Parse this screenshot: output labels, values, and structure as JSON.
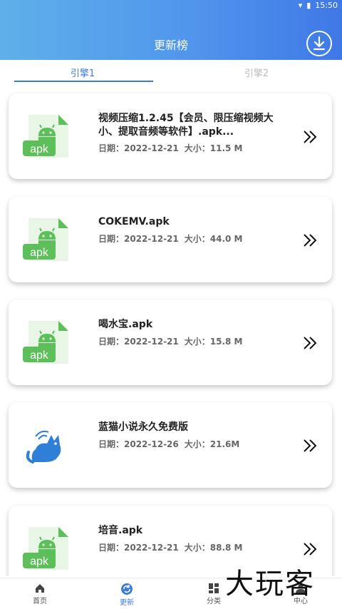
{
  "status": {
    "time": "15:50"
  },
  "header": {
    "title": "更新榜"
  },
  "tabs": [
    {
      "label": "引擎1",
      "active": true
    },
    {
      "label": "引擎2",
      "active": false
    }
  ],
  "items": [
    {
      "title": "视频压缩1.2.45【会员、限压缩视频大小、提取音频等软件】.apk...",
      "date": "日期：2022-12-21",
      "size": "大小：11.5 M",
      "icon": "apk-icon"
    },
    {
      "title": "COKEMV.apk",
      "date": "日期：2022-12-21",
      "size": "大小：44.0 M",
      "icon": "apk-icon"
    },
    {
      "title": "喝水宝.apk",
      "date": "日期：2022-12-21",
      "size": "大小：15.8 M",
      "icon": "apk-icon"
    },
    {
      "title": "蓝猫小说永久免费版",
      "date": "日期：2022-12-26",
      "size": "大小：21.6M",
      "icon": "blue-cat-icon"
    },
    {
      "title": "培音.apk",
      "date": "日期：2022-12-21",
      "size": "大小：88.8 M",
      "icon": "apk-icon"
    }
  ],
  "nav": [
    {
      "label": "首页",
      "icon": "home-icon",
      "active": false
    },
    {
      "label": "更新",
      "icon": "refresh-icon",
      "active": true
    },
    {
      "label": "分类",
      "icon": "category-icon",
      "active": false
    },
    {
      "label": "中心",
      "icon": "user-icon",
      "active": false
    }
  ],
  "watermark": "大玩客",
  "colors": {
    "accent": "#3d7bd8",
    "header_start": "#5fb0ea",
    "header_end": "#3f78e6",
    "apk_green": "#5cbf5a"
  }
}
